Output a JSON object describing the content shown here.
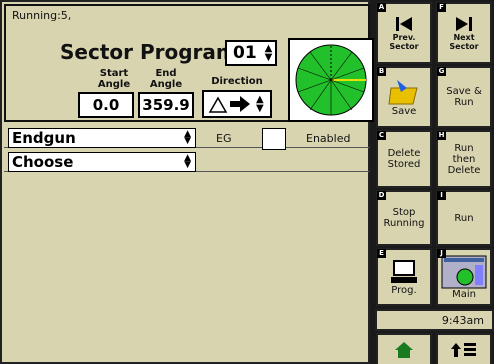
{
  "status": "Running:5,",
  "sector": {
    "title": "Sector Program:",
    "program_number": "01",
    "start_label_line1": "Start",
    "start_label_line2": "Angle",
    "end_label_line1": "End",
    "end_label_line2": "Angle",
    "direction_label": "Direction",
    "start_angle": "0.0",
    "end_angle": "359.9"
  },
  "endgun": {
    "select_value": "Endgun",
    "eg_label": "EG",
    "enabled_label": "Enabled",
    "second_select_value": "Choose"
  },
  "buttons": {
    "a_letter": "A",
    "a_label": "Prev. Sector",
    "f_letter": "F",
    "f_label": "Next Sector",
    "b_letter": "B",
    "b_label": "Save",
    "g_letter": "G",
    "g_label": "Save & Run",
    "c_letter": "C",
    "c_label": "Delete Stored",
    "h_letter": "H",
    "h_label": "Run then Delete",
    "d_letter": "D",
    "d_label": "Stop Running",
    "i_letter": "I",
    "i_label": "Run",
    "e_letter": "E",
    "e_label": "Prog.",
    "j_letter": "J",
    "j_label": "Main"
  },
  "time": "9:43am",
  "colors": {
    "panel_bg": "#d8d4b0",
    "frame": "#1a1a1a",
    "clock_green": "#22c02a",
    "clock_yellow": "#e8e000"
  },
  "icons": [
    "skip-back-icon",
    "skip-forward-icon",
    "save-folder-icon",
    "computer-icon",
    "main-map-icon",
    "home-icon",
    "up-list-icon"
  ]
}
